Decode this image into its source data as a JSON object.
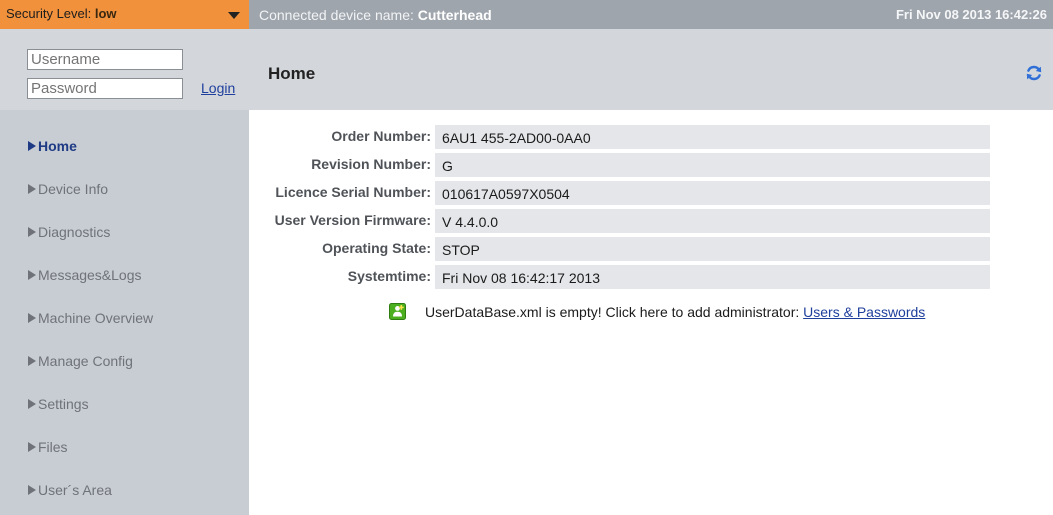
{
  "top_bar": {
    "security_prefix": "Security Level: ",
    "security_value": "low",
    "device_prefix": "Connected device name: ",
    "device_name": "Cutterhead",
    "datetime": "Fri Nov 08 2013  16:42:26"
  },
  "login": {
    "username_placeholder": "Username",
    "password_placeholder": "Password",
    "login_label": "Login"
  },
  "sidebar": {
    "items": [
      {
        "label": "Home",
        "active": true
      },
      {
        "label": "Device Info",
        "active": false
      },
      {
        "label": "Diagnostics",
        "active": false
      },
      {
        "label": "Messages&Logs",
        "active": false
      },
      {
        "label": "Machine Overview",
        "active": false
      },
      {
        "label": "Manage Config",
        "active": false
      },
      {
        "label": "Settings",
        "active": false
      },
      {
        "label": "Files",
        "active": false
      },
      {
        "label": "User´s Area",
        "active": false
      }
    ]
  },
  "main": {
    "title": "Home",
    "info_rows": [
      {
        "label": "Order Number:",
        "value": "6AU1 455-2AD00-0AA0"
      },
      {
        "label": "Revision Number:",
        "value": "G"
      },
      {
        "label": "Licence Serial Number:",
        "value": "010617A0597X0504"
      },
      {
        "label": "User Version Firmware:",
        "value": "V 4.4.0.0"
      },
      {
        "label": "Operating State:",
        "value": "STOP"
      },
      {
        "label": "Systemtime:",
        "value": "Fri Nov 08 16:42:17 2013"
      }
    ],
    "notice": {
      "text": "UserDataBase.xml is empty! Click here to add administrator: ",
      "link_label": "Users & Passwords",
      "icon": "user-add-icon"
    }
  },
  "icons": {
    "refresh": "refresh-icon",
    "dropdown": "chevron-down-icon",
    "nav_marker": "triangle-right-icon"
  },
  "colors": {
    "security_bar": "#f2913b",
    "device_bar": "#9fa5ad",
    "sidebar": "#c8cdd3",
    "header": "#d3d7dc",
    "active_nav": "#1e3a85",
    "link": "#1f3f9c",
    "notice_icon": "#4caf1f"
  }
}
